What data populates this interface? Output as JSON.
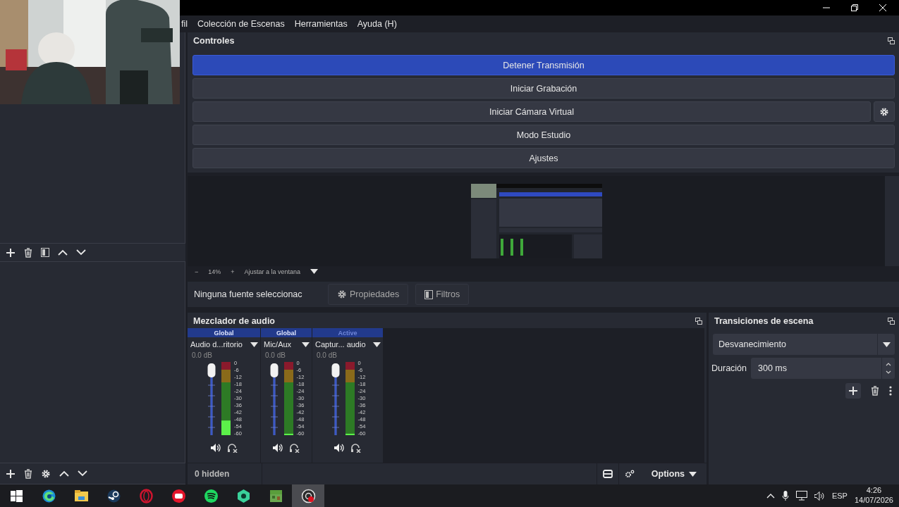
{
  "menu": [
    "fil",
    "Colección de Escenas",
    "Herramientas",
    "Ayuda (H)"
  ],
  "controls": {
    "title": "Controles",
    "buttons": [
      {
        "label": "Detener Transmisión",
        "active": true,
        "kind": "plain"
      },
      {
        "label": "Iniciar Grabación",
        "active": false,
        "kind": "plain"
      },
      {
        "label": "Iniciar Cámara Virtual",
        "active": false,
        "kind": "with-settings"
      },
      {
        "label": "Modo Estudio",
        "active": false,
        "kind": "plain"
      },
      {
        "label": "Ajustes",
        "active": false,
        "kind": "plain"
      }
    ]
  },
  "zoom": {
    "out": "−",
    "value": "14%",
    "in": "+",
    "fit": "Ajustar a la ventana"
  },
  "source_bar": {
    "status": "Ninguna fuente seleccionac",
    "properties": "Propiedades",
    "filters": "Filtros"
  },
  "mixer": {
    "title": "Mezclador de audio",
    "channels": [
      {
        "tag": "Global",
        "name": "Audio d...ritorio",
        "reading": "0.0 dB",
        "fader": {
          "level": 1
        },
        "meter": {
          "level": 0.2
        },
        "scale": [
          "0",
          "-6",
          "-12",
          "-18",
          "-24",
          "-30",
          "-36",
          "-42",
          "-48",
          "-54",
          "-60"
        ]
      },
      {
        "tag": "Global",
        "name": "Mic/Aux",
        "reading": "0.0 dB",
        "fader": {
          "level": 1
        },
        "meter": {
          "level": 0.02
        },
        "scale": [
          "0",
          "-6",
          "-12",
          "-18",
          "-24",
          "-30",
          "-36",
          "-42",
          "-48",
          "-54",
          "-60"
        ]
      },
      {
        "tag": "Active",
        "name": "Captur... audio",
        "reading": "0.0 dB",
        "fader": {
          "level": 1
        },
        "meter": {
          "level": 0.02
        },
        "scale": [
          "0",
          "-6",
          "-12",
          "-18",
          "-24",
          "-30",
          "-36",
          "-42",
          "-48",
          "-54",
          "-60"
        ]
      }
    ],
    "hidden": "0 hidden",
    "options": "Options"
  },
  "transitions": {
    "title": "Transiciones de escena",
    "selected": "Desvanecimiento",
    "duration_label": "Duración",
    "duration": "300 ms"
  },
  "taskbar": {
    "apps": [
      {
        "selected": false
      },
      {
        "selected": false
      },
      {
        "selected": false
      },
      {
        "selected": false
      },
      {
        "selected": false
      },
      {
        "selected": false
      },
      {
        "selected": false
      },
      {
        "selected": false
      },
      {
        "selected": false
      },
      {
        "selected": true
      }
    ],
    "tray": {
      "language": "ESP",
      "time": "4:26",
      "date": "14/07/2026"
    }
  }
}
